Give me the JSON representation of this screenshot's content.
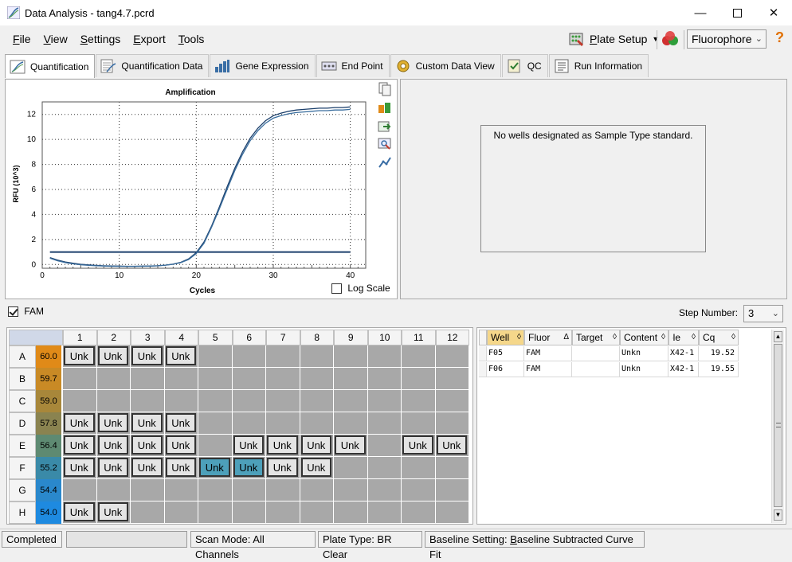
{
  "window": {
    "title": "Data Analysis - tang4.7.pcrd"
  },
  "menu": [
    {
      "key": "F",
      "rest": "ile"
    },
    {
      "key": "V",
      "rest": "iew"
    },
    {
      "key": "S",
      "rest": "ettings"
    },
    {
      "key": "E",
      "rest": "xport"
    },
    {
      "key": "T",
      "rest": "ools"
    }
  ],
  "toolbar": {
    "plate_setup": "Plate Setup",
    "plate_setup_key": "P",
    "fluorophore": "Fluorophore",
    "help": "?"
  },
  "tabs": [
    "Quantification",
    "Quantification Data",
    "Gene Expression",
    "End Point",
    "Custom Data View",
    "QC",
    "Run Information"
  ],
  "chart_data": {
    "type": "line",
    "title": "Amplification",
    "xlabel": "Cycles",
    "ylabel": "RFU (10^3)",
    "xlim": [
      0,
      42
    ],
    "ylim": [
      -0.3,
      13
    ],
    "xticks": [
      0,
      10,
      20,
      30,
      40
    ],
    "yticks": [
      0,
      2,
      4,
      6,
      8,
      10,
      12
    ],
    "grid": true,
    "log_scale_label": "Log Scale",
    "log_scale": false,
    "threshold": 1.0,
    "series": [
      {
        "x": [
          1,
          2,
          3,
          4,
          5,
          6,
          7,
          8,
          9,
          10,
          11,
          12,
          13,
          14,
          15,
          16,
          17,
          18,
          19,
          20,
          21,
          22,
          23,
          24,
          25,
          26,
          27,
          28,
          29,
          30,
          31,
          32,
          33,
          34,
          35,
          36,
          37,
          38,
          39,
          40
        ],
        "y": [
          0.55,
          0.35,
          0.2,
          0.1,
          0.02,
          -0.03,
          -0.07,
          -0.1,
          -0.12,
          -0.13,
          -0.14,
          -0.14,
          -0.13,
          -0.12,
          -0.1,
          -0.05,
          0.03,
          0.18,
          0.45,
          0.95,
          1.8,
          3.1,
          4.6,
          6.2,
          7.7,
          9.0,
          10.1,
          10.9,
          11.5,
          11.9,
          12.1,
          12.25,
          12.35,
          12.4,
          12.45,
          12.5,
          12.5,
          12.55,
          12.55,
          12.6
        ]
      },
      {
        "x": [
          1,
          2,
          3,
          4,
          5,
          6,
          7,
          8,
          9,
          10,
          11,
          12,
          13,
          14,
          15,
          16,
          17,
          18,
          19,
          20,
          21,
          22,
          23,
          24,
          25,
          26,
          27,
          28,
          29,
          30,
          31,
          32,
          33,
          34,
          35,
          36,
          37,
          38,
          39,
          40
        ],
        "y": [
          0.5,
          0.3,
          0.15,
          0.05,
          -0.02,
          -0.07,
          -0.1,
          -0.12,
          -0.14,
          -0.15,
          -0.15,
          -0.15,
          -0.14,
          -0.13,
          -0.1,
          -0.05,
          0.02,
          0.15,
          0.4,
          0.88,
          1.7,
          3.0,
          4.45,
          6.0,
          7.5,
          8.8,
          9.9,
          10.7,
          11.3,
          11.7,
          11.9,
          12.05,
          12.15,
          12.2,
          12.25,
          12.3,
          12.3,
          12.35,
          12.35,
          12.4
        ]
      }
    ]
  },
  "right_panel": {
    "message": "No wells designated as Sample Type standard."
  },
  "fam": {
    "label": "FAM",
    "checked": true
  },
  "step": {
    "label": "Step Number:",
    "value": "3"
  },
  "plate": {
    "columns": [
      "1",
      "2",
      "3",
      "4",
      "5",
      "6",
      "7",
      "8",
      "9",
      "10",
      "11",
      "12"
    ],
    "rows": [
      {
        "label": "A",
        "temp": "60.0",
        "color": "#e08a18",
        "wells": [
          "Unk",
          "Unk",
          "Unk",
          "Unk",
          "",
          "",
          "",
          "",
          "",
          "",
          "",
          ""
        ]
      },
      {
        "label": "B",
        "temp": "59.7",
        "color": "#c98a25",
        "wells": [
          "",
          "",
          "",
          "",
          "",
          "",
          "",
          "",
          "",
          "",
          "",
          ""
        ]
      },
      {
        "label": "C",
        "temp": "59.0",
        "color": "#a8873a",
        "wells": [
          "",
          "",
          "",
          "",
          "",
          "",
          "",
          "",
          "",
          "",
          "",
          ""
        ]
      },
      {
        "label": "D",
        "temp": "57.8",
        "color": "#8a8350",
        "wells": [
          "Unk",
          "Unk",
          "Unk",
          "Unk",
          "",
          "",
          "",
          "",
          "",
          "",
          "",
          ""
        ]
      },
      {
        "label": "E",
        "temp": "56.4",
        "color": "#5e8a72",
        "wells": [
          "Unk",
          "Unk",
          "Unk",
          "Unk",
          "",
          "Unk",
          "Unk",
          "Unk",
          "Unk",
          "",
          "Unk",
          "Unk"
        ]
      },
      {
        "label": "F",
        "temp": "55.2",
        "color": "#3a8aa8",
        "wells": [
          "Unk",
          "Unk",
          "Unk",
          "Unk",
          "Unk",
          "Unk",
          "Unk",
          "Unk",
          "",
          "",
          "",
          ""
        ]
      },
      {
        "label": "G",
        "temp": "54.4",
        "color": "#2a88cc",
        "wells": [
          "",
          "",
          "",
          "",
          "",
          "",
          "",
          "",
          "",
          "",
          "",
          ""
        ]
      },
      {
        "label": "H",
        "temp": "54.0",
        "color": "#1e8ae0",
        "wells": [
          "Unk",
          "Unk",
          "",
          "",
          "",
          "",
          "",
          "",
          "",
          "",
          "",
          ""
        ]
      }
    ],
    "selected": [
      "F5",
      "F6"
    ]
  },
  "table": {
    "headers": [
      "Well",
      "Fluor",
      "Target",
      "Content",
      "Sample",
      "Cq"
    ],
    "rows": [
      [
        "F05",
        "FAM",
        "",
        "Unkn",
        "X42-1",
        "19.52"
      ],
      [
        "F06",
        "FAM",
        "",
        "Unkn",
        "X42-1",
        "19.55"
      ]
    ]
  },
  "status": {
    "state": "Completed",
    "scan_mode": "Scan Mode: All Channels",
    "plate_type": "Plate Type: BR Clear",
    "baseline_prefix": "Baseline Setting: ",
    "baseline_key": "B",
    "baseline_rest": "aseline Subtracted Curve Fit"
  }
}
